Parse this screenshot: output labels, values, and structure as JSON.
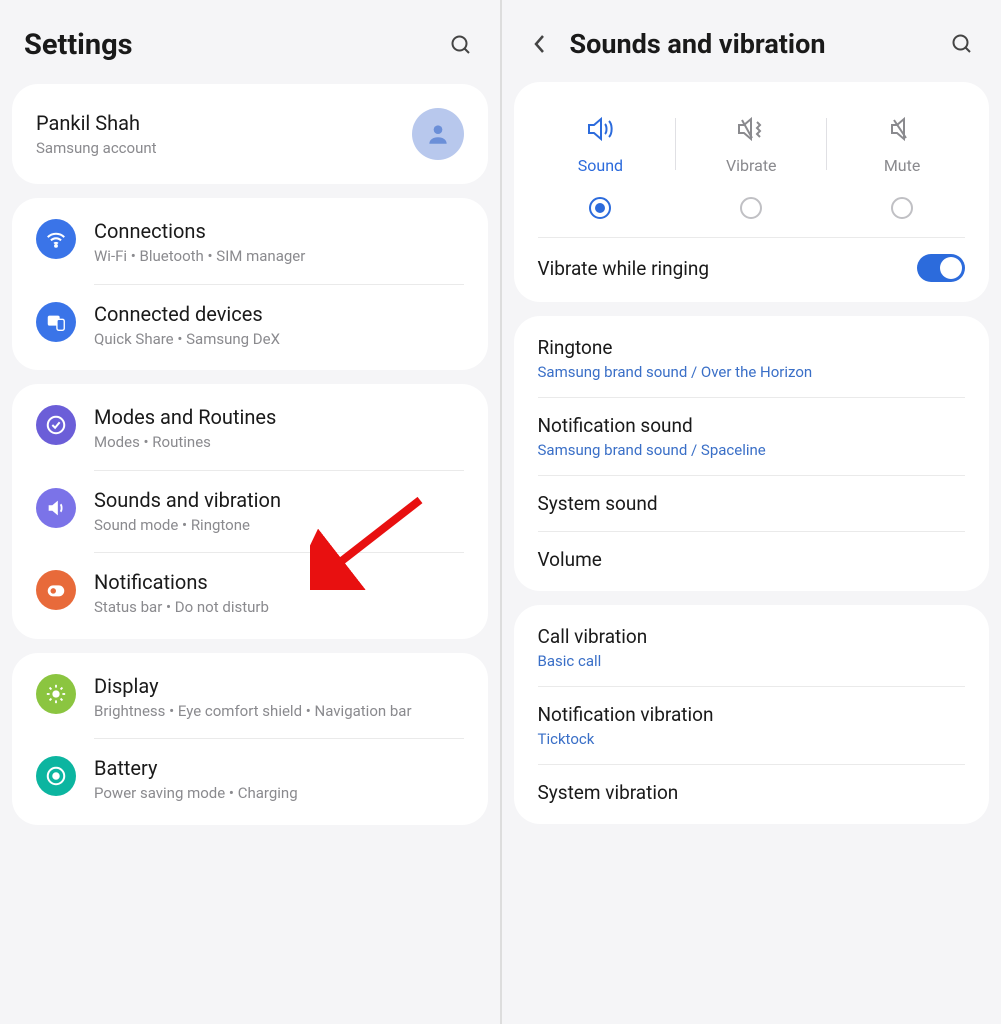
{
  "left": {
    "title": "Settings",
    "account": {
      "name": "Pankil Shah",
      "sub": "Samsung account"
    },
    "groups": [
      {
        "items": [
          {
            "icon": "wifi",
            "title": "Connections",
            "sub": "Wi-Fi • Bluetooth • SIM manager"
          },
          {
            "icon": "devices",
            "title": "Connected devices",
            "sub": "Quick Share • Samsung DeX"
          }
        ]
      },
      {
        "items": [
          {
            "icon": "modes",
            "title": "Modes and Routines",
            "sub": "Modes • Routines"
          },
          {
            "icon": "sound",
            "title": "Sounds and vibration",
            "sub": "Sound mode • Ringtone"
          },
          {
            "icon": "notif",
            "title": "Notifications",
            "sub": "Status bar • Do not disturb"
          }
        ]
      },
      {
        "items": [
          {
            "icon": "display",
            "title": "Display",
            "sub": "Brightness • Eye comfort shield • Navigation bar"
          },
          {
            "icon": "battery",
            "title": "Battery",
            "sub": "Power saving mode • Charging"
          }
        ]
      }
    ]
  },
  "right": {
    "title": "Sounds and vibration",
    "modes": [
      {
        "label": "Sound",
        "active": true
      },
      {
        "label": "Vibrate",
        "active": false
      },
      {
        "label": "Mute",
        "active": false
      }
    ],
    "vibrate_ringing": "Vibrate while ringing",
    "group1": [
      {
        "title": "Ringtone",
        "sub": "Samsung brand sound / Over the Horizon"
      },
      {
        "title": "Notification sound",
        "sub": "Samsung brand sound / Spaceline"
      },
      {
        "title": "System sound"
      },
      {
        "title": "Volume"
      }
    ],
    "group2": [
      {
        "title": "Call vibration",
        "sub": "Basic call"
      },
      {
        "title": "Notification vibration",
        "sub": "Ticktock"
      },
      {
        "title": "System vibration"
      }
    ]
  }
}
